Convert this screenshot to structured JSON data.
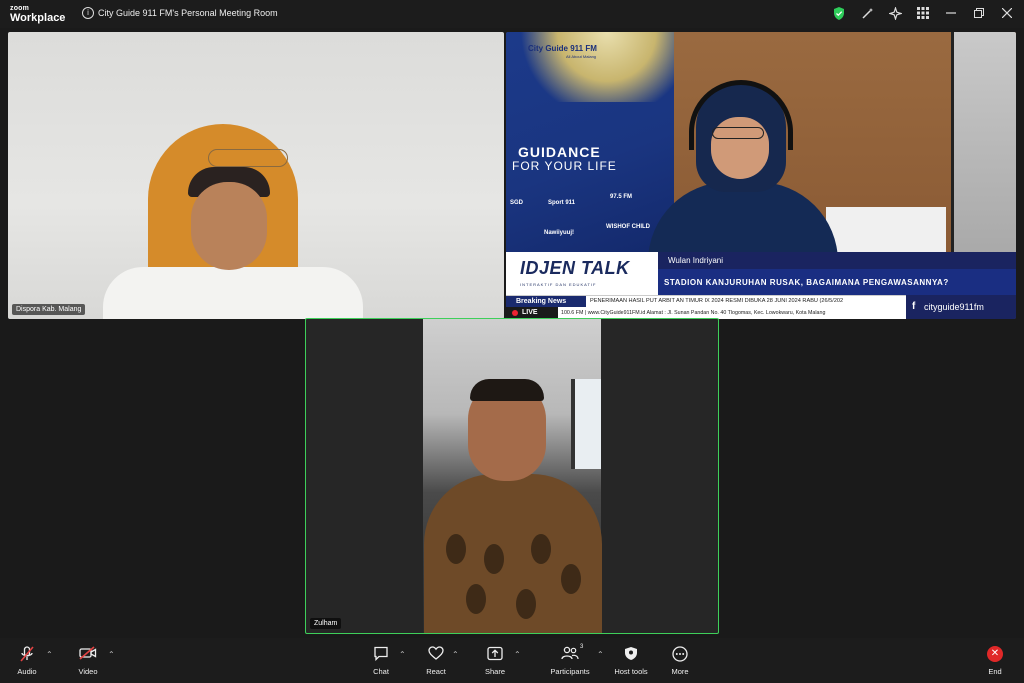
{
  "app": {
    "brand_top": "zoom",
    "brand_bottom": "Workplace",
    "window_title": "City Guide 911 FM's Personal Meeting Room"
  },
  "titlebar_icons": [
    "shield-check-icon",
    "magic-pen-icon",
    "sparkle-icon",
    "apps-grid-icon",
    "minimize-icon",
    "restore-icon",
    "close-icon"
  ],
  "accent": "#3ecf5a",
  "participants": [
    {
      "name": "Dispora Kab. Malang"
    },
    {
      "name": "Wulan Indriyani"
    },
    {
      "name": "Zulham",
      "active_speaker": true
    }
  ],
  "broadcast": {
    "logo": "City Guide 911 FM",
    "logo_sub": "All About Malang",
    "banner_line1": "GUIDANCE",
    "banner_line2": "FOR YOUR LIFE",
    "sponsors": [
      "SGD",
      "Sport 911",
      "97.5 FM",
      "WISHOF CHILD",
      "Nawiiyuuj!"
    ],
    "show_title": "IDJEN TALK",
    "show_sub": "INTERAKTIF DAN EDUKATIF",
    "host_name": "Wulan Indriyani",
    "headline": "STADION KANJURUHAN RUSAK, BAGAIMANA PENGAWASANNYA?",
    "breaking_label": "Breaking News",
    "ticker_text": "PENERIMAAN HASIL PUT ARBIT AN TIMUR IX 2024 RESMI DIBUKA 28 JUNI 2024          RABU (26/5/202",
    "live_label": "LIVE",
    "ticker2_text": "100.6 FM  |  www.CityGuide911FM.id Alamat  : Jl. Sunan Pandan No. 40 Tlogomas, Kec. Lowokwaru, Kota Malang",
    "social": "cityguide911fm"
  },
  "toolbar": {
    "audio": "Audio",
    "video": "Video",
    "chat": "Chat",
    "react": "React",
    "share": "Share",
    "participants": "Participants",
    "participants_count": "3",
    "host_tools": "Host tools",
    "more": "More",
    "end": "End"
  }
}
